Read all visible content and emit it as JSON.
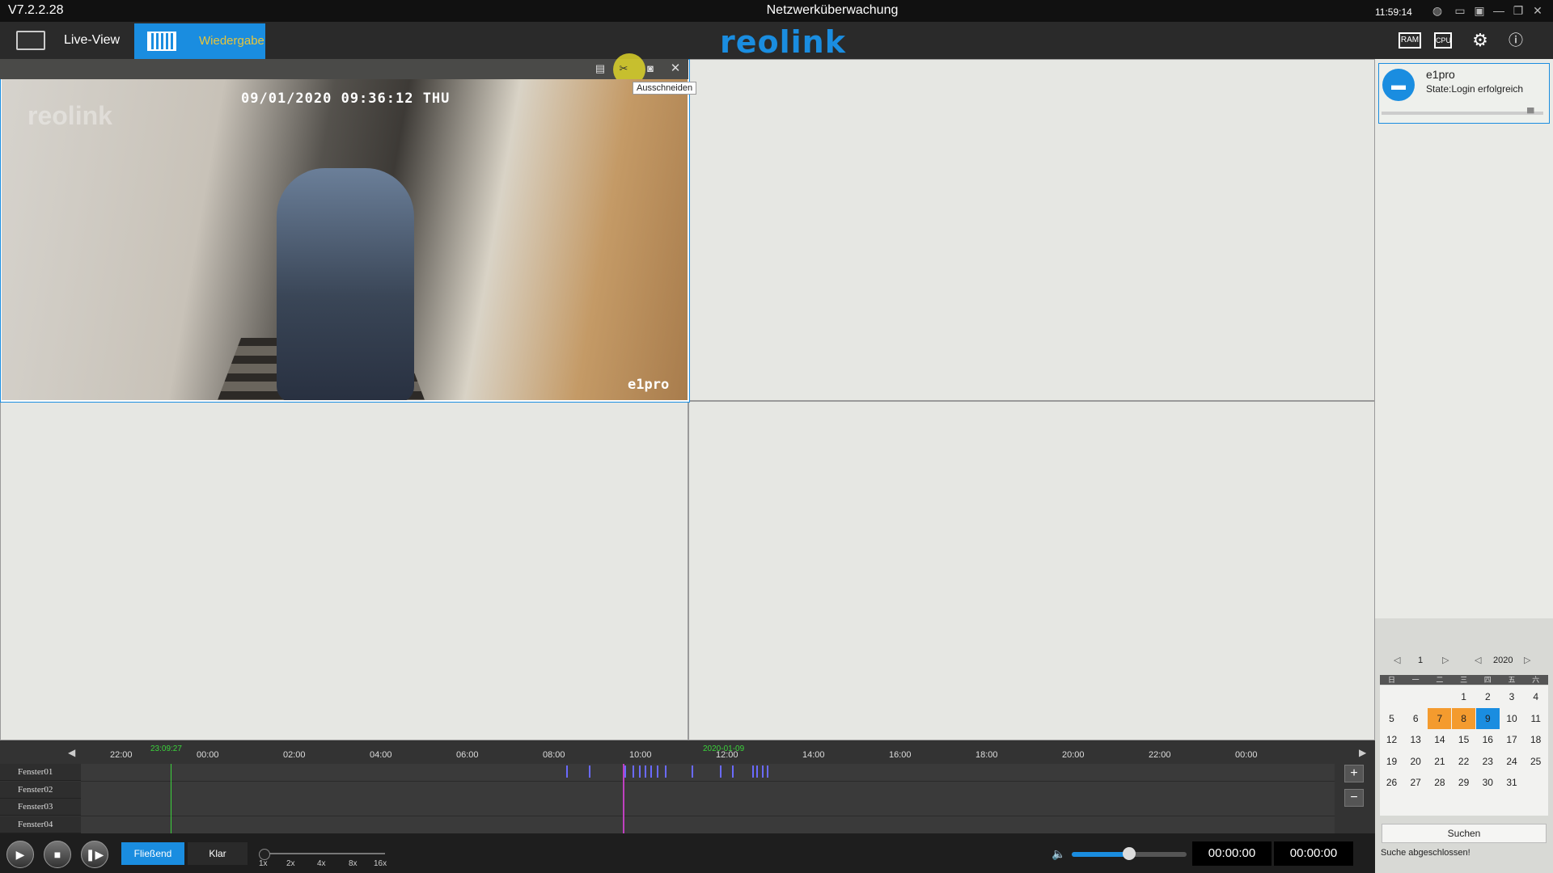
{
  "window": {
    "version": "V7.2.2.28",
    "title": "Netzwerküberwachung",
    "clock": "11:59:14"
  },
  "toolbar": {
    "live_label": "Live-View",
    "playback_label": "Wiedergabe",
    "logo": "reolink",
    "ram_label": "RAM",
    "cpu_label": "CPU"
  },
  "video": {
    "osd_time": "09/01/2020 09:36:12 THU",
    "osd_logo": "reolink",
    "channel_name": "e1pro",
    "tooltip": "Ausschneiden"
  },
  "timeline": {
    "ticks": [
      "22:00",
      "00:00",
      "02:00",
      "04:00",
      "06:00",
      "08:00",
      "10:00",
      "12:00",
      "14:00",
      "16:00",
      "18:00",
      "20:00",
      "22:00",
      "00:00"
    ],
    "current_time": "23:09:27",
    "date_marker": "2020-01-09",
    "rows": [
      "Fenster01",
      "Fenster02",
      "Fenster03",
      "Fenster04"
    ]
  },
  "controls": {
    "mode_fluent": "Fließend",
    "mode_clear": "Klar",
    "speeds": [
      "1x",
      "2x",
      "4x",
      "8x",
      "16x"
    ],
    "volume_level": 0.5,
    "time_start": "00:00:00",
    "time_end": "00:00:00"
  },
  "device": {
    "name": "e1pro",
    "state": "State:Login erfolgreich"
  },
  "calendar": {
    "month": "1",
    "year": "2020",
    "weekdays": [
      "日",
      "一",
      "二",
      "三",
      "四",
      "五",
      "六"
    ],
    "weeks": [
      [
        "",
        "",
        "",
        "1",
        "2",
        "3",
        "4"
      ],
      [
        "5",
        "6",
        "7",
        "8",
        "9",
        "10",
        "11"
      ],
      [
        "12",
        "13",
        "14",
        "15",
        "16",
        "17",
        "18"
      ],
      [
        "19",
        "20",
        "21",
        "22",
        "23",
        "24",
        "25"
      ],
      [
        "26",
        "27",
        "28",
        "29",
        "30",
        "31",
        ""
      ]
    ],
    "recorded_days": [
      "7",
      "8"
    ],
    "selected_day": "9",
    "search_label": "Suchen",
    "search_status": "Suche abgeschlossen!"
  },
  "colors": {
    "accent": "#1a8de0",
    "recorded_day": "#f49b2e",
    "playhead": "#3bd23b",
    "event": "#6a6aff"
  }
}
